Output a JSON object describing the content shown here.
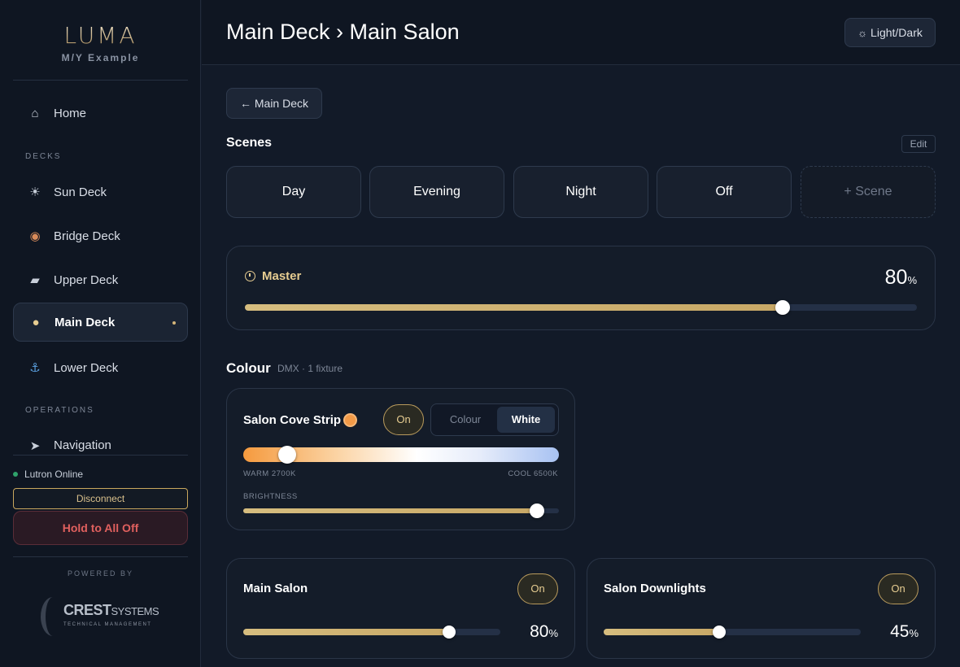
{
  "brand": {
    "logo": "LUMA",
    "subtitle": "M/Y Example"
  },
  "sidebar": {
    "home": {
      "label": "Home",
      "icon": "home-icon"
    },
    "decks_heading": "DECKS",
    "decks": [
      {
        "label": "Sun Deck",
        "icon": "sun-icon"
      },
      {
        "label": "Bridge Deck",
        "icon": "compass-icon"
      },
      {
        "label": "Upper Deck",
        "icon": "boat-icon"
      },
      {
        "label": "Main Deck",
        "icon": "dining-icon",
        "active": true
      },
      {
        "label": "Lower Deck",
        "icon": "anchor-icon"
      }
    ],
    "operations_heading": "OPERATIONS",
    "operations": [
      {
        "label": "Navigation",
        "icon": "navigation-arrow-icon"
      }
    ],
    "status": "Lutron Online",
    "disconnect_label": "Disconnect",
    "all_off_label": "Hold to All Off",
    "powered_by": "POWERED BY",
    "partner": {
      "name_bold": "CREST",
      "name_light": "SYSTEMS",
      "tagline": "TECHNICAL MANAGEMENT"
    }
  },
  "header": {
    "title": "Main Deck › Main Salon",
    "theme_toggle": "Light/Dark"
  },
  "main": {
    "back_label": "← Main Deck",
    "scenes_title": "Scenes",
    "edit_label": "Edit",
    "scenes": [
      "Day",
      "Evening",
      "Night",
      "Off"
    ],
    "add_scene_label": "+ Scene",
    "master": {
      "label": "Master",
      "value": "80",
      "unit": "%",
      "level": 0.8
    },
    "colour_section": {
      "title": "Colour",
      "subtitle": "DMX · 1 fixture",
      "fixture": {
        "name": "Salon Cove Strip",
        "swatch_color": "#f39a47",
        "state_label": "On",
        "mode_options": [
          "Colour",
          "White"
        ],
        "selected_mode": "White",
        "temp_warm_label": "WARM 2700K",
        "temp_cool_label": "COOL 6500K",
        "temp_level": 0.14,
        "brightness_label": "BRIGHTNESS",
        "brightness_level": 0.93
      }
    },
    "loads": [
      {
        "name": "Main Salon",
        "state_label": "On",
        "value": "80",
        "unit": "%",
        "level": 0.8
      },
      {
        "name": "Salon Downlights",
        "state_label": "On",
        "value": "45",
        "unit": "%",
        "level": 0.45
      }
    ]
  },
  "colors": {
    "accent_gold": "#e6cc91",
    "danger": "#e0605e",
    "online": "#2fa36b",
    "background": "#121a28"
  }
}
